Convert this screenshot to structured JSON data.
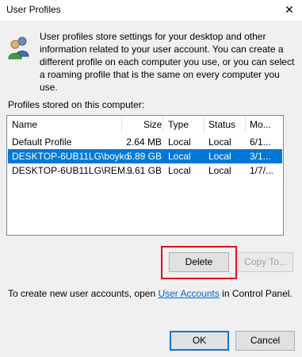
{
  "window": {
    "title": "User Profiles",
    "close_glyph": "✕"
  },
  "info": {
    "icon": "users-icon",
    "text": "User profiles store settings for your desktop and other information related to your user account. You can create a different profile on each computer you use, or you can select a roaming profile that is the same on every computer you use."
  },
  "profiles": {
    "label": "Profiles stored on this computer:",
    "columns": [
      "Name",
      "Size",
      "Type",
      "Status",
      "Mo..."
    ],
    "rows": [
      {
        "name": "Default Profile",
        "size": "2.64 MB",
        "type": "Local",
        "status": "Local",
        "modified": "6/1...",
        "selected": false
      },
      {
        "name": "DESKTOP-6UB11LG\\boyko",
        "size": "5.89 GB",
        "type": "Local",
        "status": "Local",
        "modified": "3/1...",
        "selected": true
      },
      {
        "name": "DESKTOP-6UB11LG\\REM...",
        "size": "9.61 GB",
        "type": "Local",
        "status": "Local",
        "modified": "1/7/...",
        "selected": false
      }
    ]
  },
  "buttons": {
    "delete": "Delete",
    "copy_to": "Copy To...",
    "ok": "OK",
    "cancel": "Cancel"
  },
  "footer": {
    "prefix": "To create new user accounts, open ",
    "link": "User Accounts",
    "suffix": " in Control Panel."
  },
  "colors": {
    "selection": "#0078d7",
    "highlight": "#e0101a",
    "link": "#0066cc"
  }
}
